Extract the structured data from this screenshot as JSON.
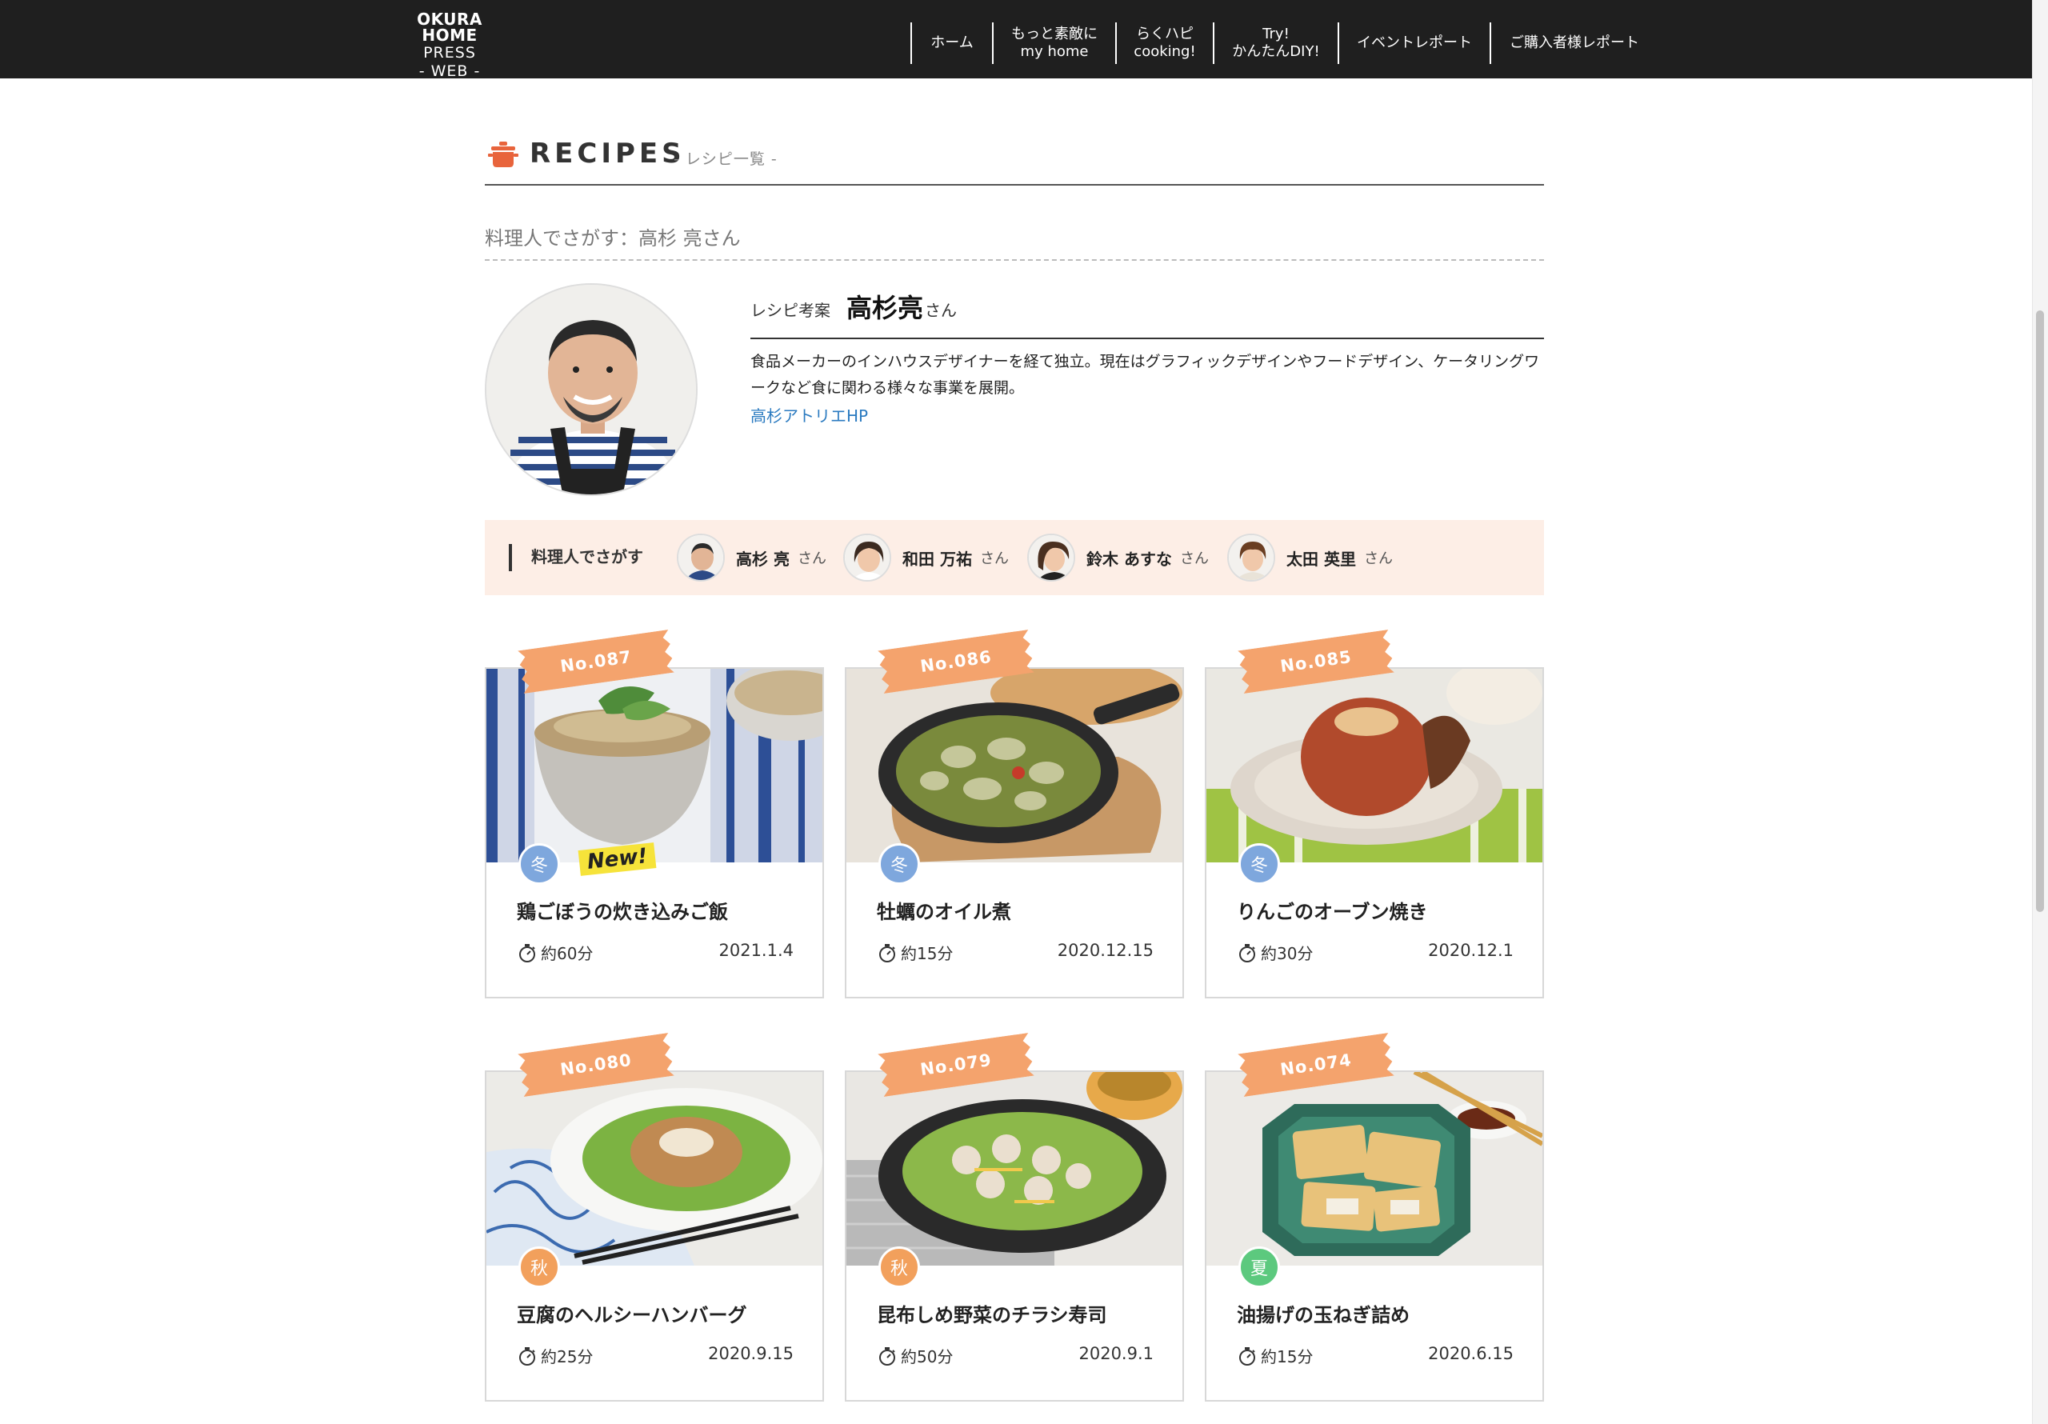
{
  "header": {
    "logo": {
      "line1": "OKURA HOME",
      "line2": "PRESS",
      "line3": "- WEB -"
    },
    "nav": [
      {
        "line1": "ホーム",
        "line2": ""
      },
      {
        "line1": "もっと素敵に",
        "line2": "my home"
      },
      {
        "line1": "らくハピ",
        "line2": "cooking!"
      },
      {
        "line1": "Try!",
        "line2": "かんたんDIY!"
      },
      {
        "line1": "イベントレポート",
        "line2": ""
      },
      {
        "line1": "ご購入者様レポート",
        "line2": ""
      }
    ]
  },
  "section": {
    "title": "RECIPES",
    "subtitle": "- レシピ一覧 -",
    "search_label": "料理人でさがす：高杉 亮さん"
  },
  "profile": {
    "role": "レシピ考案",
    "name": "高杉亮",
    "honorific": "さん",
    "description": "食品メーカーのインハウスデザイナーを経て独立。現在はグラフィックデザインやフードデザイン、ケータリングワークなど食に関わる様々な事業を展開。",
    "link": "高杉アトリエHP"
  },
  "chef_search": {
    "label": "料理人でさがす",
    "chefs": [
      {
        "name": "高杉 亮",
        "honorific": "さん"
      },
      {
        "name": "和田 万祐",
        "honorific": "さん"
      },
      {
        "name": "鈴木 あすな",
        "honorific": "さん"
      },
      {
        "name": "太田 英里",
        "honorific": "さん"
      }
    ]
  },
  "recipes": [
    {
      "number": "No.087",
      "season": "冬",
      "title": "鶏ごぼうの炊き込みご飯",
      "time": "約60分",
      "date": "2021.1.4",
      "is_new": true,
      "new_label": "New!"
    },
    {
      "number": "No.086",
      "season": "冬",
      "title": "牡蠣のオイル煮",
      "time": "約15分",
      "date": "2020.12.15",
      "is_new": false
    },
    {
      "number": "No.085",
      "season": "冬",
      "title": "りんごのオーブン焼き",
      "time": "約30分",
      "date": "2020.12.1",
      "is_new": false
    },
    {
      "number": "No.080",
      "season": "秋",
      "title": "豆腐のヘルシーハンバーグ",
      "time": "約25分",
      "date": "2020.9.15",
      "is_new": false
    },
    {
      "number": "No.079",
      "season": "秋",
      "title": "昆布しめ野菜のチラシ寿司",
      "time": "約50分",
      "date": "2020.9.1",
      "is_new": false
    },
    {
      "number": "No.074",
      "season": "夏",
      "title": "油揚げの玉ねぎ詰め",
      "time": "約15分",
      "date": "2020.6.15",
      "is_new": false
    }
  ],
  "colors": {
    "header_bg": "#1f1f1f",
    "ribbon": "#f4a36d",
    "season_winter": "#7ea7dd",
    "season_autumn": "#f2a05c",
    "season_summer": "#5cc97e",
    "chef_bar_bg": "#fdeee6",
    "link": "#2a7ac0"
  }
}
